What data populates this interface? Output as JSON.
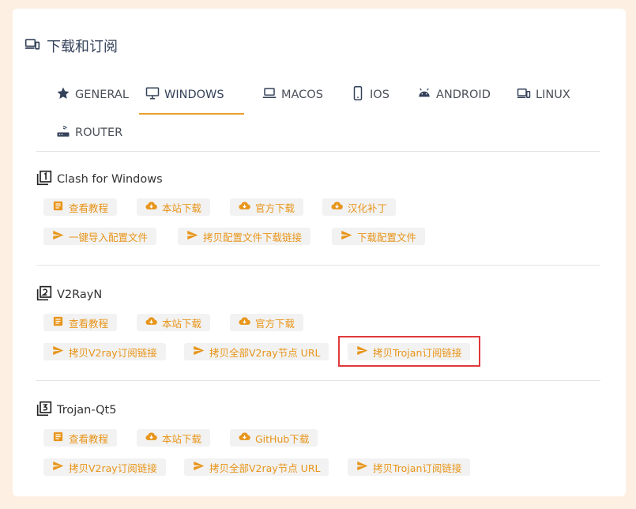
{
  "title": "下载和订阅",
  "tabs": [
    {
      "label": "GENERAL",
      "icon": "star-icon"
    },
    {
      "label": "WINDOWS",
      "icon": "monitor-icon",
      "active": true
    },
    {
      "label": "MACOS",
      "icon": "laptop-icon"
    },
    {
      "label": "IOS",
      "icon": "phone-icon"
    },
    {
      "label": "ANDROID",
      "icon": "android-icon"
    },
    {
      "label": "LINUX",
      "icon": "devices-icon"
    },
    {
      "label": "ROUTER",
      "icon": "router-icon"
    }
  ],
  "sections": [
    {
      "title": "Clash for Windows",
      "row1": [
        "查看教程",
        "本站下载",
        "官方下载",
        "汉化补丁"
      ],
      "row2": [
        "一键导入配置文件",
        "拷贝配置文件下载链接",
        "下载配置文件"
      ]
    },
    {
      "title": "V2RayN",
      "row1": [
        "查看教程",
        "本站下载",
        "官方下载"
      ],
      "row2": [
        "拷贝V2ray订阅链接",
        "拷贝全部V2ray节点 URL",
        "拷贝Trojan订阅链接"
      ]
    },
    {
      "title": "Trojan-Qt5",
      "row1": [
        "查看教程",
        "本站下载",
        "GitHub下载"
      ],
      "row2": [
        "拷贝V2ray订阅链接",
        "拷贝全部V2ray节点 URL",
        "拷贝Trojan订阅链接"
      ]
    }
  ],
  "colors": {
    "accent": "#e8951a",
    "tab_underline": "#e8a02a",
    "highlight": "#e0393a",
    "page_bg": "#fdf0e3"
  }
}
